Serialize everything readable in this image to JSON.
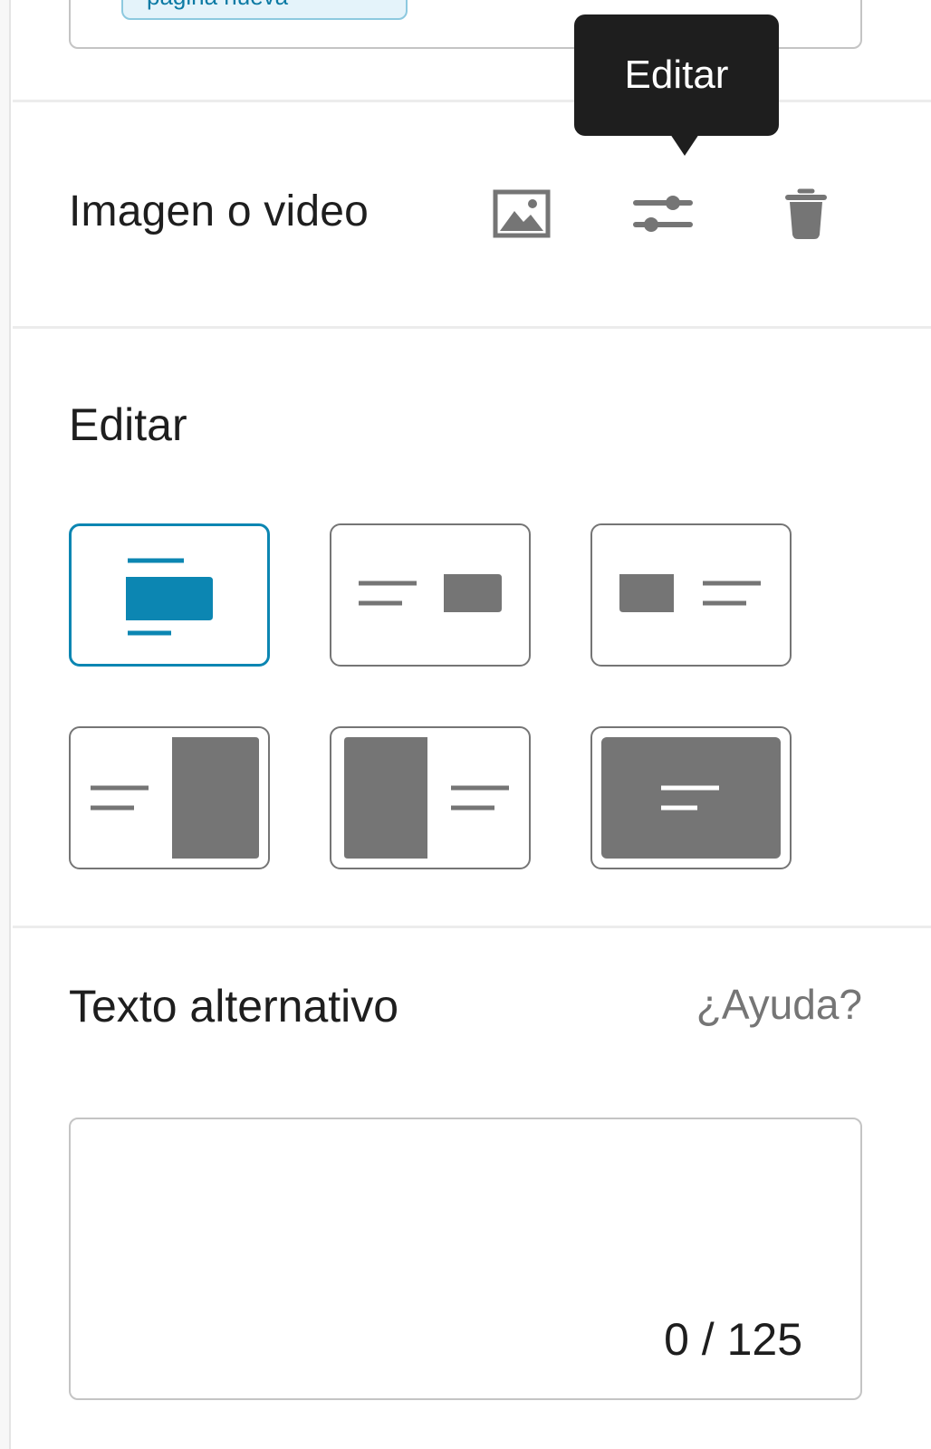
{
  "top_card": {
    "chip_text": "página nueva"
  },
  "media": {
    "label": "Imagen o video",
    "actions": [
      {
        "name": "image-icon"
      },
      {
        "name": "adjustments-icon"
      },
      {
        "name": "trash-icon"
      }
    ]
  },
  "tooltip": {
    "text": "Editar"
  },
  "edit_section": {
    "title": "Editar",
    "layout_options": [
      {
        "name": "layout-image-top-centered",
        "selected": true
      },
      {
        "name": "layout-image-right",
        "selected": false
      },
      {
        "name": "layout-image-left",
        "selected": false
      },
      {
        "name": "layout-image-right-tall",
        "selected": false
      },
      {
        "name": "layout-image-left-tall",
        "selected": false
      },
      {
        "name": "layout-image-background",
        "selected": false
      }
    ]
  },
  "alt_text": {
    "label": "Texto alternativo",
    "help": "¿Ayuda?",
    "value": "",
    "counter": "0 / 125"
  },
  "colors": {
    "accent": "#0c86b2",
    "icon_gray": "#757575",
    "text": "#1e1e1e",
    "tooltip_bg": "#1e1e1e"
  }
}
